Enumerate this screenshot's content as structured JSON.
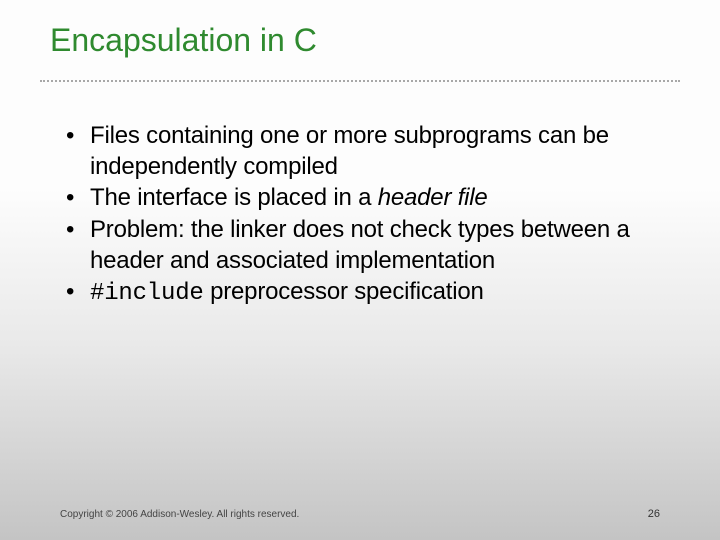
{
  "slide": {
    "title": "Encapsulation in C",
    "bullets": [
      {
        "segments": [
          {
            "text": "Files containing one or more subprograms can be independently compiled",
            "style": "plain"
          }
        ]
      },
      {
        "segments": [
          {
            "text": "The interface is placed in a ",
            "style": "plain"
          },
          {
            "text": "header file",
            "style": "italic"
          }
        ]
      },
      {
        "segments": [
          {
            "text": "Problem: the linker does not check types between a header and associated implementation",
            "style": "plain"
          }
        ]
      },
      {
        "segments": [
          {
            "text": "#include",
            "style": "code"
          },
          {
            "text": " preprocessor specification",
            "style": "plain"
          }
        ]
      }
    ]
  },
  "footer": {
    "copyright": "Copyright © 2006 Addison-Wesley. All rights reserved.",
    "page": "26"
  }
}
